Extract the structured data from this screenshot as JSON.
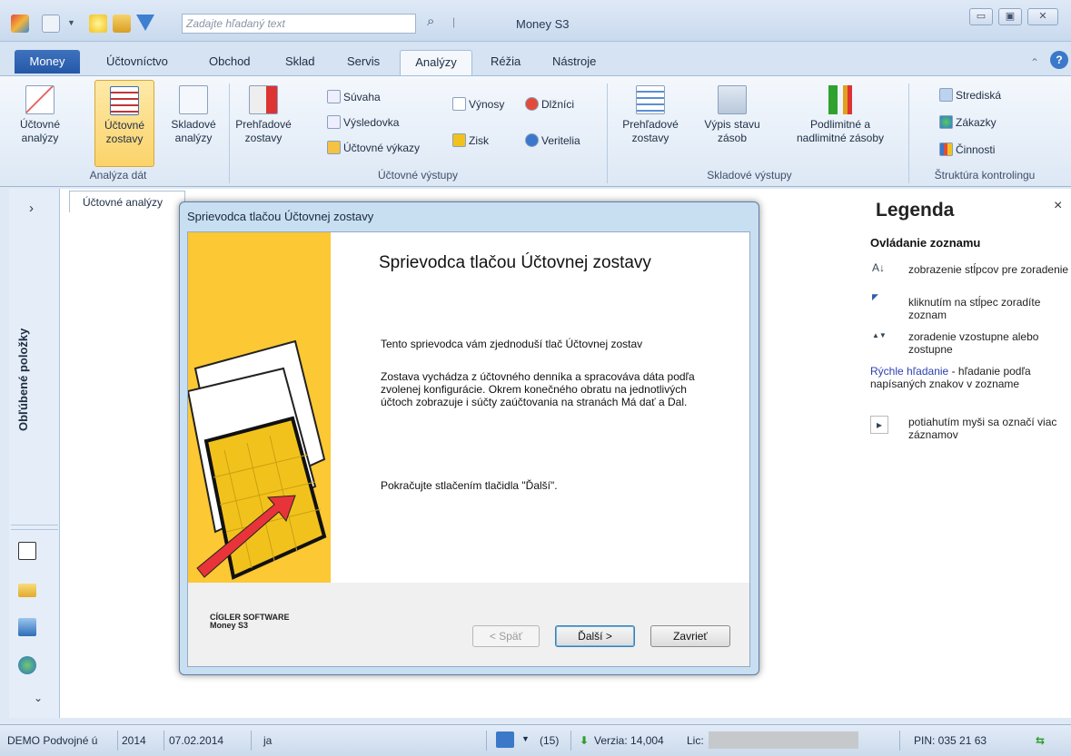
{
  "app": {
    "title": "Money S3",
    "search_placeholder": "Zadajte hľadaný text"
  },
  "window_buttons": {
    "minimize": "▭",
    "maximize": "▣",
    "close": "✕"
  },
  "tabs": [
    {
      "label": "Money"
    },
    {
      "label": "Účtovníctvo"
    },
    {
      "label": "Obchod"
    },
    {
      "label": "Sklad"
    },
    {
      "label": "Servis"
    },
    {
      "label": "Analýzy"
    },
    {
      "label": "Réžia"
    },
    {
      "label": "Nástroje"
    }
  ],
  "ribbon": {
    "analyza_dat": {
      "group": "Analýza dát",
      "b1": [
        "Účtovné",
        "analýzy"
      ],
      "b2": [
        "Účtovné",
        "zostavy"
      ],
      "b3": [
        "Skladové",
        "analýzy"
      ]
    },
    "uctovne_vystupy": {
      "group": "Účtovné výstupy",
      "b1": [
        "Prehľadové",
        "zostavy"
      ],
      "small": [
        "Súvaha",
        "Výsledovka",
        "Účtovné výkazy",
        "Výnosy",
        "Zisk",
        "Dlžníci",
        "Veritelia"
      ]
    },
    "skladove_vystupy": {
      "group": "Skladové výstupy",
      "b1": [
        "Prehľadové",
        "zostavy"
      ],
      "b2": [
        "Výpis stavu",
        "zásob"
      ],
      "b3": [
        "Podlimitné a",
        "nadlimitné zásoby"
      ]
    },
    "struktura": {
      "group": "Štruktúra kontrolingu",
      "small": [
        "Strediská",
        "Zákazky",
        "Činnosti"
      ]
    }
  },
  "left_panel": {
    "collapse": "›",
    "favorites": "Obľúbené položky",
    "down": "⌄"
  },
  "doc_tab": "Účtovné analýzy",
  "dialog": {
    "title": "Sprievodca tlačou Účtovnej zostavy",
    "heading": "Sprievodca tlačou Účtovnej zostavy",
    "p1": "Tento sprievodca vám zjednoduší tlač Účtovnej zostav",
    "p2": "Zostava vychádza z účtovného denníka a spracováva dáta podľa zvolenej konfigurácie. Okrem konečného obratu na jednotlivých účtoch zobrazuje i súčty zaúčtovania na stranách Má dať a Dal.",
    "p3": "Pokračujte stlačením tlačidla \"Ďalší\".",
    "logo1": "CÍGLER SOFTWARE",
    "logo2": "Money S3",
    "btn_back": "< Späť",
    "btn_next": "Ďalší >",
    "btn_close": "Zavrieť"
  },
  "legend": {
    "title": "Legenda",
    "close": "×",
    "subtitle": "Ovládanie zoznamu",
    "items": [
      {
        "icon": "A↓",
        "text": "zobrazenie stĺpcov pre zoradenie"
      },
      {
        "icon": "◤",
        "text": "kliknutím na stĺpec zoradíte zoznam"
      },
      {
        "icon": "▲▼",
        "text": "zoradenie vzostupne alebo zostupne"
      },
      {
        "lead": "Rýchle hľadanie",
        "text": " - hľadanie podľa napísaných znakov v zozname"
      },
      {
        "icon": "▸",
        "text": "potiahutím myši sa označí viac záznamov"
      }
    ]
  },
  "status": {
    "company": "DEMO Podvojné ú",
    "year": "2014",
    "date": "07.02.2014",
    "user": "ja",
    "rss_count": "(15)",
    "version": "Verzia: 14,004",
    "lic": "Lic:",
    "pin": "PIN: 035 21 63"
  }
}
